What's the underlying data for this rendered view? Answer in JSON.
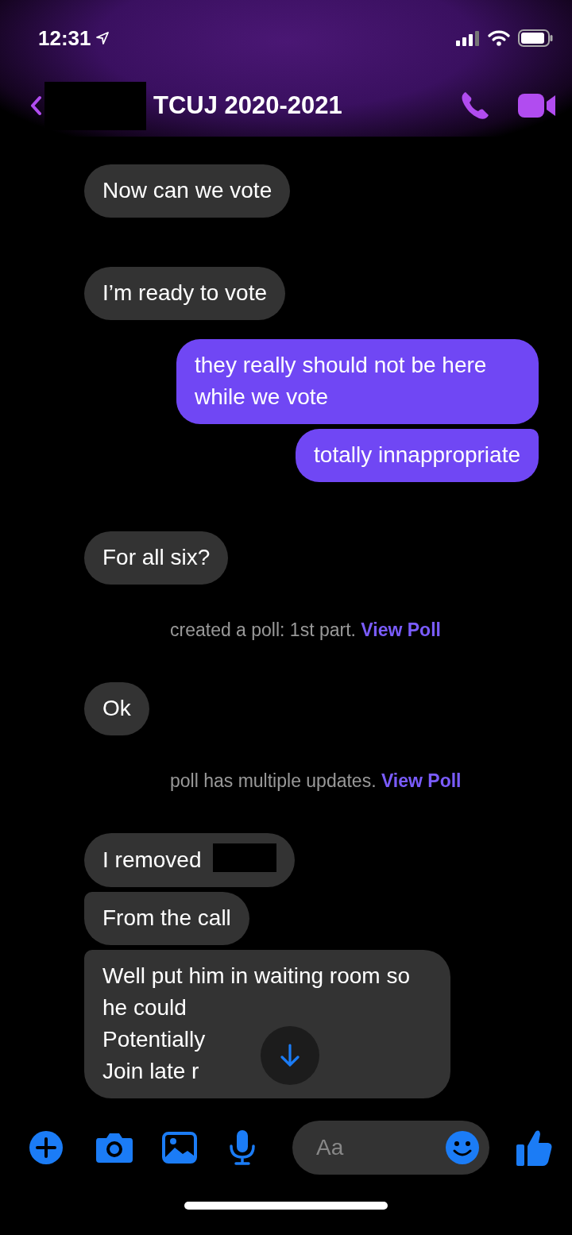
{
  "status_bar": {
    "time": "12:31"
  },
  "header": {
    "title": "TCUJ 2020-2021"
  },
  "messages": [
    {
      "kind": "incoming",
      "continued": false,
      "text": "Now can we vote"
    },
    {
      "kind": "incoming",
      "continued": false,
      "text": "I’m ready to vote"
    },
    {
      "kind": "outgoing",
      "continued": false,
      "text": "they really should not be here while we vote"
    },
    {
      "kind": "outgoing",
      "continued": true,
      "text": "totally innappropriate"
    },
    {
      "kind": "incoming",
      "continued": false,
      "text": "For all six?"
    },
    {
      "kind": "system",
      "text": "created a poll: 1st part.",
      "link": "View Poll"
    },
    {
      "kind": "incoming",
      "continued": false,
      "text": "Ok"
    },
    {
      "kind": "system",
      "text": "poll has multiple updates.",
      "link": "View Poll"
    },
    {
      "kind": "incoming",
      "continued": false,
      "text": "I removed",
      "redacted": true
    },
    {
      "kind": "incoming",
      "continued": true,
      "text": "From the call"
    },
    {
      "kind": "incoming",
      "continued": true,
      "text": "Well put him in waiting room so he could\nPotentially\nJoin late r"
    }
  ],
  "composer": {
    "placeholder": "Aa"
  }
}
